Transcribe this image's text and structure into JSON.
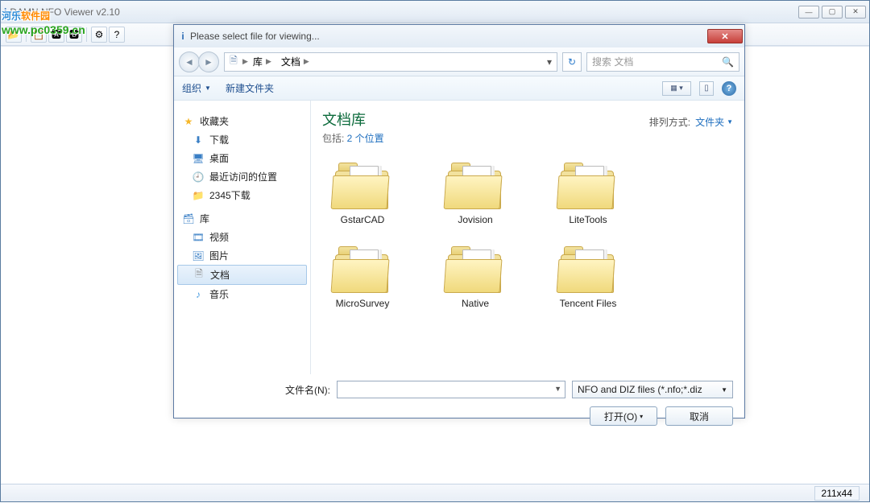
{
  "main_window": {
    "title": "DAMN NFO Viewer v2.10",
    "status": "211x44"
  },
  "watermark": {
    "line1a": "河乐",
    "line1b": "软件园",
    "url": "www.pc0359.cn"
  },
  "dialog": {
    "title": "Please select file for viewing...",
    "breadcrumb": {
      "part1": "库",
      "part2": "文档"
    },
    "search_placeholder": "搜索 文档",
    "toolbar": {
      "organize": "组织",
      "newfolder": "新建文件夹"
    },
    "sidebar": {
      "favorites": "收藏夹",
      "downloads": "下载",
      "desktop": "桌面",
      "recent": "最近访问的位置",
      "dl2345": "2345下载",
      "library": "库",
      "video": "视频",
      "pictures": "图片",
      "documents": "文档",
      "music": "音乐"
    },
    "content": {
      "title": "文档库",
      "subtitle_prefix": "包括: ",
      "subtitle_count": "2 个位置",
      "sort_label": "排列方式:",
      "sort_value": "文件夹",
      "items": [
        {
          "name": "GstarCAD"
        },
        {
          "name": "Jovision"
        },
        {
          "name": "LiteTools"
        },
        {
          "name": "MicroSurvey"
        },
        {
          "name": "Native"
        },
        {
          "name": "Tencent Files"
        }
      ]
    },
    "filename_label": "文件名(N):",
    "filter": "NFO and DIZ files (*.nfo;*.diz",
    "open": "打开(O)",
    "cancel": "取消"
  }
}
